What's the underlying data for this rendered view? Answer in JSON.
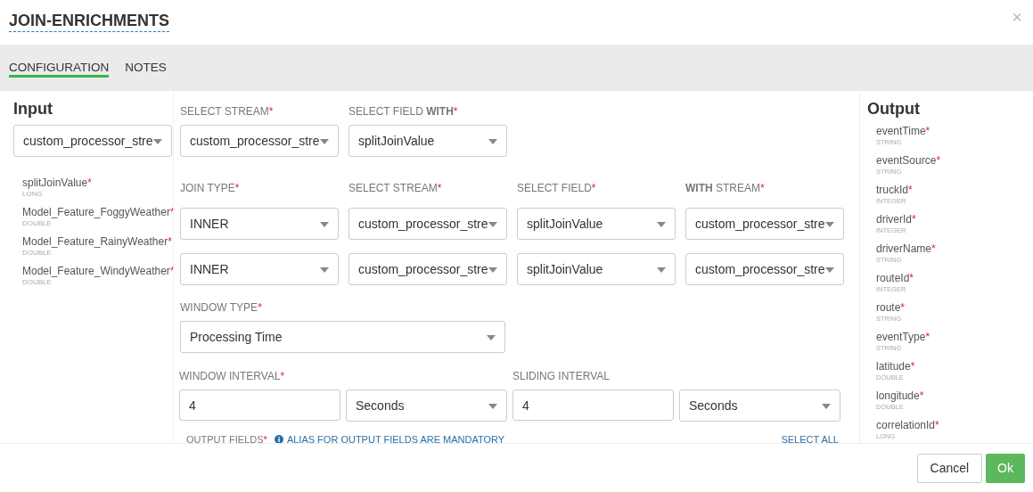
{
  "window": {
    "title": "JOIN-ENRICHMENTS",
    "close": "×"
  },
  "tabs": [
    {
      "label": "CONFIGURATION",
      "selected": true
    },
    {
      "label": "NOTES",
      "selected": false
    }
  ],
  "input": {
    "title": "Input",
    "stream": "custom_processor_stre",
    "fields": [
      {
        "name": "splitJoinValue",
        "mark": "*",
        "type": "LONG"
      },
      {
        "name": "Model_Feature_FoggyWeather",
        "mark": "*",
        "type": "DOUBLE"
      },
      {
        "name": "Model_Feature_RainyWeather",
        "mark": "*",
        "type": "DOUBLE"
      },
      {
        "name": "Model_Feature_WindyWeather",
        "mark": "*",
        "type": "DOUBLE"
      }
    ]
  },
  "source": [
    {
      "label": "SELECT STREAM",
      "mark": "*",
      "value": "custom_processor_stre"
    },
    {
      "label": "SELECT FIELD **WITH**",
      "mark": "*",
      "value": "splitJoinValue"
    }
  ],
  "joins": {
    "headers": [
      {
        "label": "JOIN TYPE",
        "mark": "*"
      },
      {
        "label": "SELECT STREAM",
        "mark": "*"
      },
      {
        "label": "SELECT FIELD",
        "mark": "*"
      },
      {
        "label": "**WITH** STREAM",
        "mark": "*"
      }
    ],
    "rows": [
      [
        "INNER",
        "custom_processor_stre",
        "splitJoinValue",
        "custom_processor_stre"
      ],
      [
        "INNER",
        "custom_processor_stre",
        "splitJoinValue",
        "custom_processor_stre"
      ]
    ]
  },
  "window_type": {
    "label": "WINDOW TYPE",
    "mark": "*",
    "value": "Processing Time"
  },
  "intervals": [
    {
      "label": "WINDOW INTERVAL",
      "mark": "*",
      "value": "4",
      "unit": "Seconds"
    },
    {
      "label": "SLIDING INTERVAL",
      "value": "4",
      "unit": "Seconds"
    }
  ],
  "output_fields": {
    "label": "OUTPUT FIELDS",
    "mark": "*",
    "note": "ALIAS FOR OUTPUT FIELDS ARE MANDATORY",
    "select_all": "SELECT ALL"
  },
  "output": {
    "title": "Output",
    "fields": [
      {
        "name": "eventTime",
        "mark": "*",
        "type": "STRING"
      },
      {
        "name": "eventSource",
        "mark": "*",
        "type": "STRING"
      },
      {
        "name": "truckId",
        "mark": "*",
        "type": "INTEGER"
      },
      {
        "name": "driverId",
        "mark": "*",
        "type": "INTEGER"
      },
      {
        "name": "driverName",
        "mark": "*",
        "type": "STRING"
      },
      {
        "name": "routeId",
        "mark": "*",
        "type": "INTEGER"
      },
      {
        "name": "route",
        "mark": "*",
        "type": "STRING"
      },
      {
        "name": "eventType",
        "mark": "*",
        "type": "STRING"
      },
      {
        "name": "latitude",
        "mark": "*",
        "type": "DOUBLE"
      },
      {
        "name": "longitude",
        "mark": "*",
        "type": "DOUBLE"
      },
      {
        "name": "correlationId",
        "mark": "*",
        "type": "LONG"
      }
    ]
  },
  "buttons": [
    {
      "label": "Cancel",
      "kind": "default"
    },
    {
      "label": "Ok",
      "kind": "primary"
    }
  ]
}
